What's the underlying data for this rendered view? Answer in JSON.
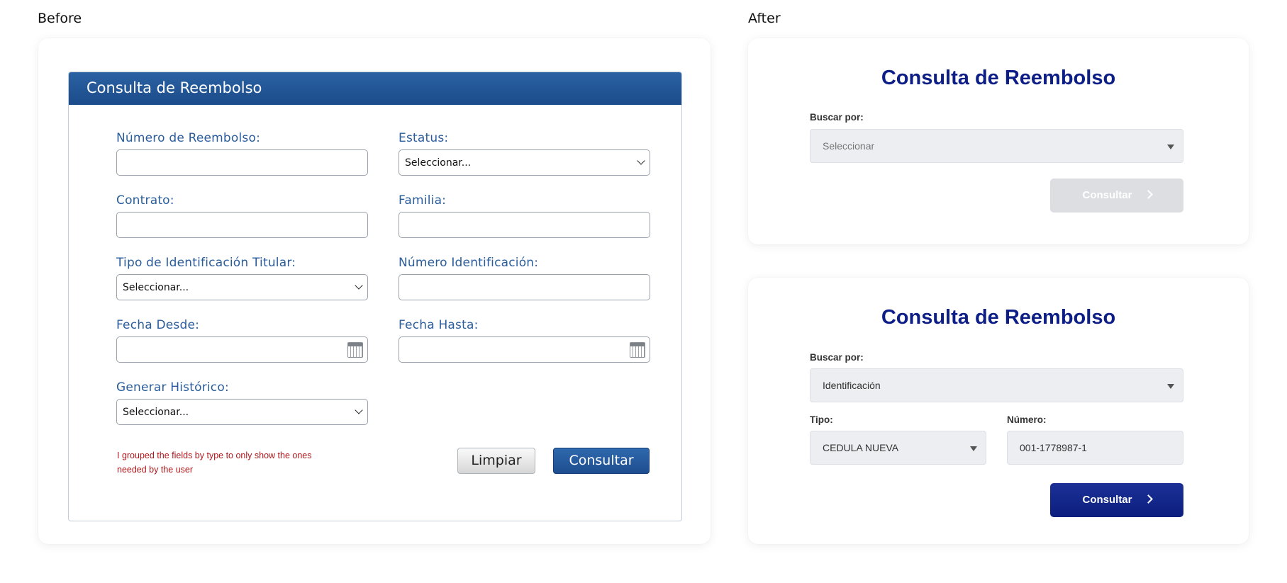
{
  "labels": {
    "before": "Before",
    "after": "After"
  },
  "before": {
    "title": "Consulta de Reembolso",
    "fields": {
      "numero_reembolso": "Número de Reembolso:",
      "estatus": "Estatus:",
      "contrato": "Contrato:",
      "familia": "Familia:",
      "tipo_identificacion": "Tipo de Identificación Titular:",
      "numero_identificacion": "Número Identificación:",
      "fecha_desde": "Fecha Desde:",
      "fecha_hasta": "Fecha Hasta:",
      "generar_historico": "Generar Histórico:"
    },
    "select_default": "Seleccionar...",
    "note": "I grouped the fields by type to only show the ones needed by the user",
    "buttons": {
      "clear": "Limpiar",
      "submit": "Consultar"
    }
  },
  "after_empty": {
    "title": "Consulta de Reembolso",
    "search_by_label": "Buscar por:",
    "search_by_value": "Seleccionar",
    "submit": "Consultar"
  },
  "after_filled": {
    "title": "Consulta de Reembolso",
    "search_by_label": "Buscar por:",
    "search_by_value": "Identificación",
    "tipo_label": "Tipo:",
    "tipo_value": "CEDULA NUEVA",
    "numero_label": "Número:",
    "numero_value": "001-1778987-1",
    "submit": "Consultar"
  },
  "colors": {
    "legacy_header": "#1b4b8a",
    "legacy_label": "#2a5d9c",
    "note": "#b0161b",
    "modern_title": "#0d1f86",
    "button_active": "#0c1f7f",
    "button_disabled": "#dcdee2"
  }
}
